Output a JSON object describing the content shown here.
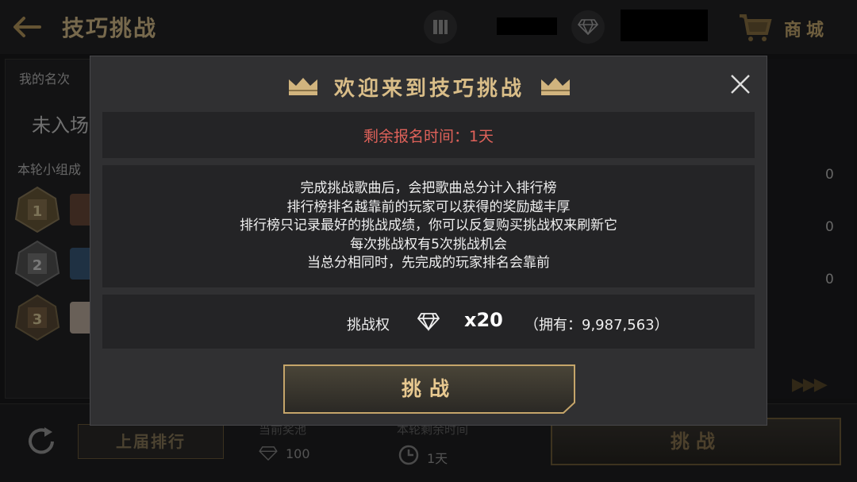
{
  "header": {
    "title": "技巧挑战",
    "shop_label": "商城"
  },
  "background": {
    "my_rank_label": "我的名次",
    "my_rank_value": "未入场",
    "group_label": "本轮小组成",
    "ranks": [
      "1",
      "2",
      "3"
    ],
    "scores": [
      "0",
      "0",
      "0"
    ],
    "prev_rank_button": "上届排行",
    "prize_pool_label": "当前奖池",
    "prize_pool_value": "100",
    "round_time_label": "本轮剩余时间",
    "round_time_value": "1天",
    "challenge_button": "挑战"
  },
  "modal": {
    "title": "欢迎来到技巧挑战",
    "deadline": "剩余报名时间：1天",
    "rules": [
      "完成挑战歌曲后，会把歌曲总分计入排行榜",
      "排行榜排名越靠前的玩家可以获得的奖励越丰厚",
      "排行榜只记录最好的挑战成绩，你可以反复购买挑战权来刷新它",
      "每次挑战权有5次挑战机会",
      "当总分相同时，先完成的玩家排名会靠前"
    ],
    "cost_label": "挑战权",
    "cost_amount": "x20",
    "owned": "（拥有：9,987,563）",
    "challenge_button": "挑战"
  },
  "colors": {
    "accent_gold": "#d9bd88",
    "deadline_red": "#e0625a",
    "modal_bg": "#303032"
  },
  "icons": [
    "back-arrow-icon",
    "pause-icon",
    "diamond-icon",
    "cart-icon",
    "crown-icon",
    "close-icon",
    "refresh-icon",
    "clock-icon"
  ]
}
